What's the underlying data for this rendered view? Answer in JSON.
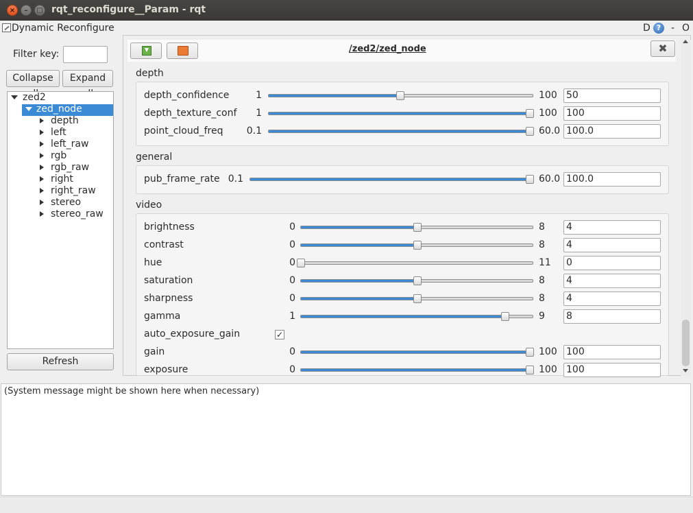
{
  "window": {
    "title": "rqt_reconfigure__Param - rqt",
    "close_glyph": "×",
    "min_glyph": "–",
    "max_glyph": "□"
  },
  "plugin": {
    "title": "Dynamic Reconfigure",
    "d_label": "D",
    "help_label": "?",
    "dash_label": "-",
    "o_label": "O"
  },
  "left": {
    "filter_label": "Filter key:",
    "filter_value": "",
    "collapse_label": "Collapse all",
    "expand_label": "Expand all",
    "refresh_label": "Refresh",
    "tree": {
      "root": "zed2",
      "node": "zed_node",
      "children": [
        "depth",
        "left",
        "left_raw",
        "rgb",
        "rgb_raw",
        "right",
        "right_raw",
        "stereo",
        "stereo_raw"
      ]
    }
  },
  "node_panel": {
    "title": "/zed2/zed_node",
    "close_glyph": "✖",
    "groups": {
      "depth": {
        "label": "depth",
        "params": [
          {
            "name": "depth_confidence",
            "min": "1",
            "max": "100",
            "value": "50",
            "fraction": 0.495
          },
          {
            "name": "depth_texture_conf",
            "min": "1",
            "max": "100",
            "value": "100",
            "fraction": 1.0
          },
          {
            "name": "point_cloud_freq",
            "min": "0.1",
            "max": "60.0",
            "value": "100.0",
            "fraction": 1.0
          }
        ]
      },
      "general": {
        "label": "general",
        "params": [
          {
            "name": "pub_frame_rate",
            "min": "0.1",
            "max": "60.0",
            "value": "100.0",
            "fraction": 1.0
          }
        ]
      },
      "video": {
        "label": "video",
        "params": [
          {
            "name": "brightness",
            "min": "0",
            "max": "8",
            "value": "4",
            "fraction": 0.5
          },
          {
            "name": "contrast",
            "min": "0",
            "max": "8",
            "value": "4",
            "fraction": 0.5
          },
          {
            "name": "hue",
            "min": "0",
            "max": "11",
            "value": "0",
            "fraction": 0.0
          },
          {
            "name": "saturation",
            "min": "0",
            "max": "8",
            "value": "4",
            "fraction": 0.5
          },
          {
            "name": "sharpness",
            "min": "0",
            "max": "8",
            "value": "4",
            "fraction": 0.5
          },
          {
            "name": "gamma",
            "min": "1",
            "max": "9",
            "value": "8",
            "fraction": 0.875
          },
          {
            "name": "auto_exposure_gain",
            "checkbox": true,
            "checked_glyph": "✓"
          },
          {
            "name": "gain",
            "min": "0",
            "max": "100",
            "value": "100",
            "fraction": 1.0
          },
          {
            "name": "exposure",
            "min": "0",
            "max": "100",
            "value": "100",
            "fraction": 1.0
          }
        ]
      }
    }
  },
  "messages": {
    "text": "(System message might be shown here when necessary)"
  },
  "colors": {
    "accent": "#3a8ad6",
    "titlebar": "#3d3c39",
    "close_button": "#e8582a"
  },
  "icons": {
    "save": "save-params-icon",
    "load": "load-params-icon",
    "help": "help-icon",
    "close": "close-icon"
  }
}
